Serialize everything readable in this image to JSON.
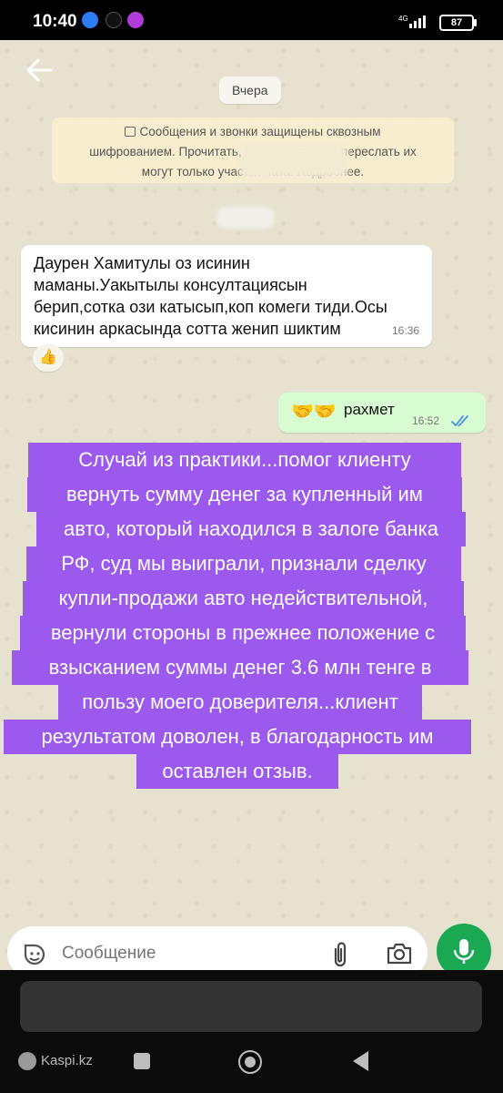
{
  "status_bar": {
    "time": "10:40",
    "network": "4G",
    "battery": "87"
  },
  "chat": {
    "date_label": "Вчера",
    "encryption_notice": [
      "Сообщения и звонки защищены сквозным",
      "шифрованием. Прочитать, прослушать или переслать их",
      "могут только участ… чата. Подробнее."
    ],
    "incoming": {
      "lines": [
        "Даурен Хамитулы оз исинин",
        "маманы.Уакытылы консултациясын",
        "берип,сотка ози катысып,коп комеги тиди.Осы",
        "кисинин аркасында сотта женип шиктим"
      ],
      "time": "16:36",
      "reaction": "thumbs-up"
    },
    "outgoing": {
      "emoji": "🤝🤝",
      "text": "рахмет",
      "time": "16:52",
      "status": "read"
    }
  },
  "overlay": {
    "lines": [
      "Случай из практики...помог клиенту",
      "вернуть сумму денег за купленный им",
      "авто, который находился в залоге банка",
      "РФ, суд мы выиграли, признали сделку",
      "купли-продажи авто недействительной,",
      "вернули стороны в прежнее положение с",
      "взысканием суммы денег 3.6 млн тенге в",
      "пользу моего доверителя...клиент",
      "результатом доволен, в благодарность им",
      "оставлен отзыв."
    ],
    "color": "#9b59ee"
  },
  "composer": {
    "placeholder": "Сообщение"
  },
  "footer": {
    "watermark": "Kaspi.kz"
  }
}
